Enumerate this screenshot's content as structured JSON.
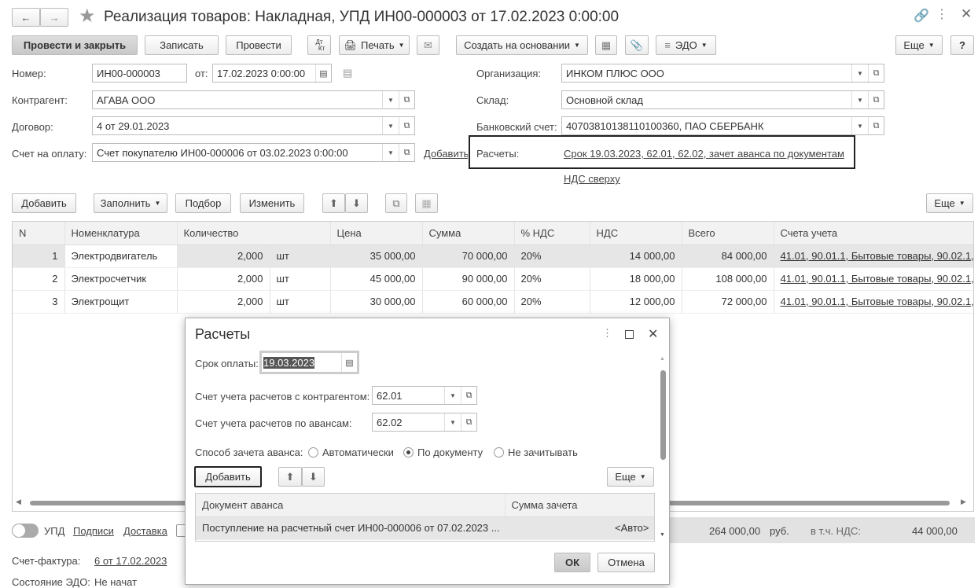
{
  "window": {
    "title": "Реализация товаров: Накладная, УПД ИН00-000003 от 17.02.2023 0:00:00"
  },
  "toolbar": {
    "post_close": "Провести и закрыть",
    "save": "Записать",
    "post": "Провести",
    "dtkt_top": "Дт",
    "dtkt_bottom": "Кт",
    "print": "Печать",
    "create_based": "Создать на основании",
    "edo": "ЭДО",
    "more": "Еще",
    "help": "?"
  },
  "header": {
    "number_label": "Номер:",
    "number": "ИН00-000003",
    "from_label": "от:",
    "date": "17.02.2023  0:00:00",
    "counterparty_label": "Контрагент:",
    "counterparty": "АГАВА  ООО",
    "contract_label": "Договор:",
    "contract": "4 от 29.01.2023",
    "invoice_label": "Счет на оплату:",
    "invoice": "Счет покупателю ИН00-000006 от 03.02.2023 0:00:00",
    "add_link": "Добавить",
    "org_label": "Организация:",
    "org": "ИНКОМ ПЛЮС ООО",
    "warehouse_label": "Склад:",
    "warehouse": "Основной склад",
    "bank_label": "Банковский счет:",
    "bank": "40703810138110100360, ПАО СБЕРБАНК",
    "settlements_label": "Расчеты:",
    "settlements": "Срок 19.03.2023, 62.01, 62.02, зачет аванса по документам",
    "vat_link": "НДС сверху"
  },
  "table_toolbar": {
    "add": "Добавить",
    "fill": "Заполнить",
    "select": "Подбор",
    "change": "Изменить",
    "more": "Еще"
  },
  "table": {
    "columns": [
      "N",
      "Номенклатура",
      "Количество",
      "",
      "Цена",
      "Сумма",
      "% НДС",
      "НДС",
      "Всего",
      "Счета учета"
    ],
    "rows": [
      {
        "n": "1",
        "item": "Электродвигатель",
        "qty": "2,000",
        "unit": "шт",
        "price": "35 000,00",
        "sum": "70 000,00",
        "vat_rate": "20%",
        "vat": "14 000,00",
        "total": "84 000,00",
        "accounts": "41.01, 90.01.1, Бытовые товары, 90.02.1,"
      },
      {
        "n": "2",
        "item": "Электросчетчик",
        "qty": "2,000",
        "unit": "шт",
        "price": "45 000,00",
        "sum": "90 000,00",
        "vat_rate": "20%",
        "vat": "18 000,00",
        "total": "108 000,00",
        "accounts": "41.01, 90.01.1, Бытовые товары, 90.02.1,"
      },
      {
        "n": "3",
        "item": "Электрощит",
        "qty": "2,000",
        "unit": "шт",
        "price": "30 000,00",
        "sum": "60 000,00",
        "vat_rate": "20%",
        "vat": "12 000,00",
        "total": "72 000,00",
        "accounts": "41.01, 90.01.1, Бытовые товары, 90.02.1,"
      }
    ]
  },
  "footer": {
    "upd": "УПД",
    "signatures": "Подписи",
    "delivery": "Доставка",
    "total": "264 000,00",
    "currency": "руб.",
    "vat_label": "в т.ч. НДС:",
    "vat_total": "44 000,00",
    "invoice_label": "Счет-фактура:",
    "invoice_link": "6 от 17.02.2023",
    "edo_label": "Состояние ЭДО:",
    "edo_value": "Не начат"
  },
  "dialog": {
    "title": "Расчеты",
    "due_label": "Срок оплаты:",
    "due": "19.03.2023",
    "acc_label": "Счет учета расчетов с контрагентом:",
    "acc": "62.01",
    "adv_label": "Счет учета расчетов по авансам:",
    "adv": "62.02",
    "method_label": "Способ зачета аванса:",
    "methods": [
      "Автоматически",
      "По документу",
      "Не зачитывать"
    ],
    "method_selected": 1,
    "add": "Добавить",
    "more": "Еще",
    "columns": [
      "Документ аванса",
      "Сумма зачета"
    ],
    "rows": [
      {
        "doc": "Поступление на расчетный счет ИН00-000006 от 07.02.2023 ...",
        "sum": "<Авто>"
      }
    ],
    "ok": "ОК",
    "cancel": "Отмена"
  }
}
